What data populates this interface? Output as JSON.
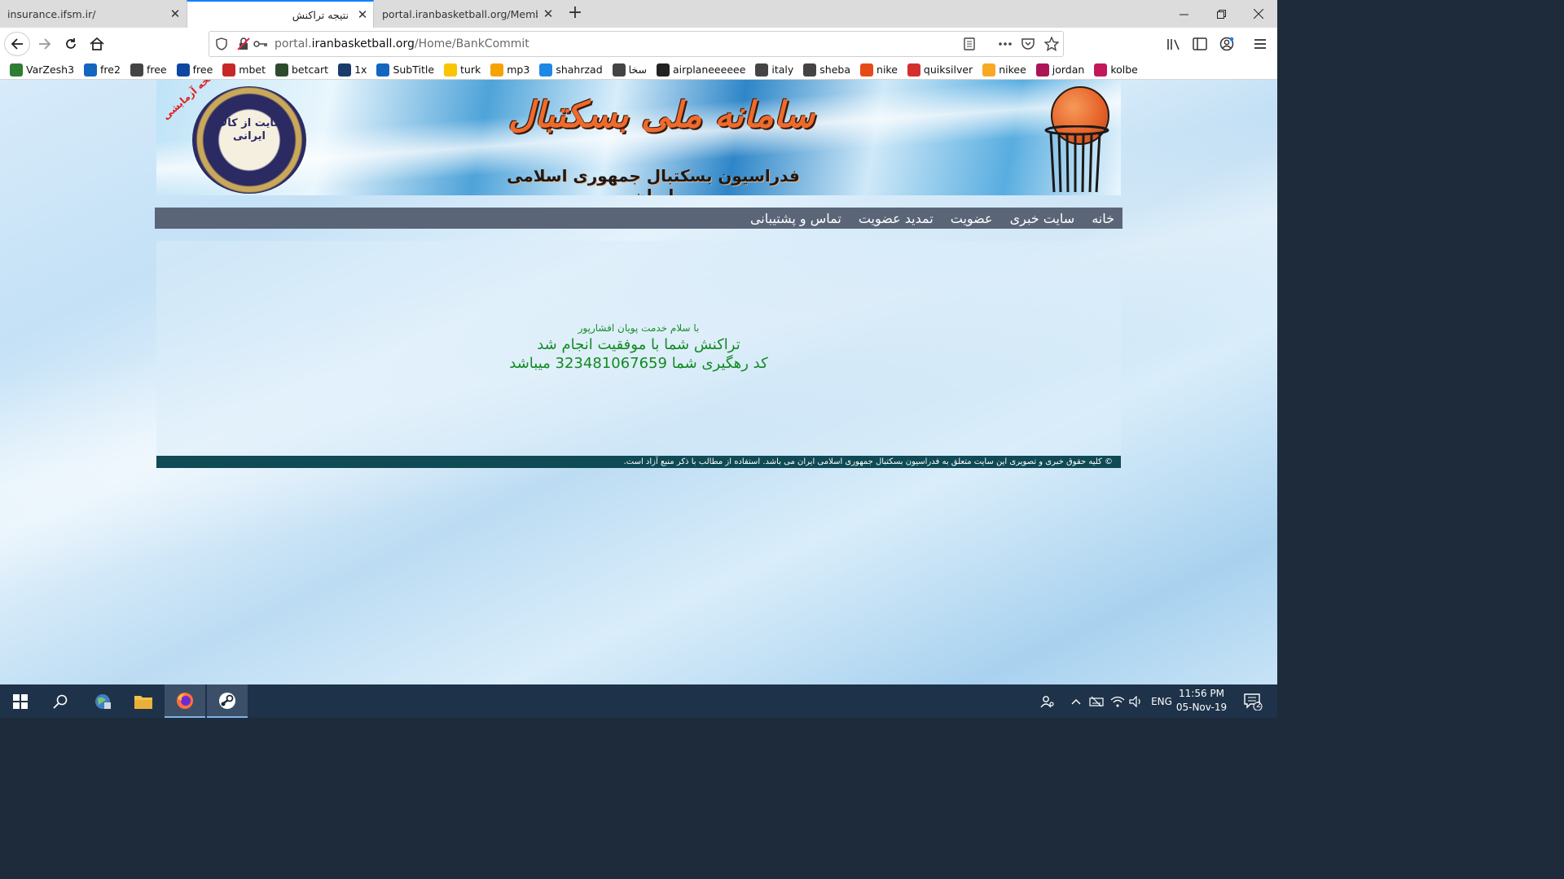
{
  "browser": {
    "tabs": [
      {
        "label": "insurance.ifsm.ir/",
        "close": "✕"
      },
      {
        "label": "نتیجه تراکنش",
        "close": "✕"
      },
      {
        "label": "portal.iranbasketball.org/Member/",
        "close": "✕"
      }
    ],
    "new_tab": "+",
    "url": {
      "domain_prefix": "portal.",
      "domain": "iranbasketball.org",
      "path": "/Home/BankCommit"
    },
    "bookmarks": [
      {
        "label": "VarZesh3",
        "icon": "varzesh3-icon",
        "color": "#2e7d32"
      },
      {
        "label": "fre2",
        "icon": "location-pin-icon",
        "color": "#1565c0"
      },
      {
        "label": "free",
        "icon": "tv-outline-icon",
        "color": "#444444"
      },
      {
        "label": "free",
        "icon": "tv-blue-icon",
        "color": "#0d47a1"
      },
      {
        "label": "mbet",
        "icon": "mbet-icon",
        "color": "#c62828"
      },
      {
        "label": "betcart",
        "icon": "betcart-icon",
        "color": "#2e4a2e"
      },
      {
        "label": "1x",
        "icon": "1xbet-icon",
        "color": "#1a3a6b"
      },
      {
        "label": "SubTitle",
        "icon": "download-icon",
        "color": "#1565c0"
      },
      {
        "label": "turk",
        "icon": "turk-icon",
        "color": "#f9c400"
      },
      {
        "label": "mp3",
        "icon": "headphones-icon",
        "color": "#f4a300"
      },
      {
        "label": "shahrzad",
        "icon": "shahrzad-icon",
        "color": "#1e88e5"
      },
      {
        "label": "سخا",
        "icon": "globe-icon",
        "color": "#444444"
      },
      {
        "label": "airplaneeeeee",
        "icon": "podcast-icon",
        "color": "#222222"
      },
      {
        "label": "italy",
        "icon": "globe-icon",
        "color": "#444444"
      },
      {
        "label": "sheba",
        "icon": "globe-icon",
        "color": "#444444"
      },
      {
        "label": "nike",
        "icon": "nike-icon",
        "color": "#e64a19"
      },
      {
        "label": "quiksilver",
        "icon": "quiksilver-icon",
        "color": "#d32f2f"
      },
      {
        "label": "nikee",
        "icon": "nikee-icon",
        "color": "#f9a825"
      },
      {
        "label": "jordan",
        "icon": "jordan-icon",
        "color": "#ad1457"
      },
      {
        "label": "kolbe",
        "icon": "kolbe-icon",
        "color": "#c2185b"
      }
    ]
  },
  "page": {
    "banner": {
      "title": "سامانه ملی بسکتبال",
      "subtitle": "فدراسیون بسکتبال جمهوری اسلامی ایران",
      "trial_label": "نسخه آزمایشی",
      "seal_text": "حمایت از کالای ایرانی"
    },
    "menu": [
      "خانه",
      "سایت خبری",
      "عضویت",
      "تمدید عضویت",
      "تماس و پشتیبانی"
    ],
    "message": {
      "greeting": "با سلام خدمت پویان افشارپور",
      "success": "تراکنش شما با موفقیت انجام شد",
      "tracking": "کد رهگیری شما 323481067659 میباشد"
    },
    "footer": "©  کلیه حقوق خبری و تصویری این سایت متعلق به فدراسیون بسکتبال جمهوری اسلامی ایران می باشد. استفاده از مطالب با ذکر منبع آزاد است."
  },
  "taskbar": {
    "language": "ENG",
    "time": "11:56 PM",
    "date": "05-Nov-19",
    "notification_count": "2"
  },
  "colors": {
    "accent": "#0a84ff",
    "menu_bg": "#5a6678",
    "footer_bg": "#0f4a55",
    "success_text": "#118a22",
    "banner_title": "#ee6a2d"
  }
}
